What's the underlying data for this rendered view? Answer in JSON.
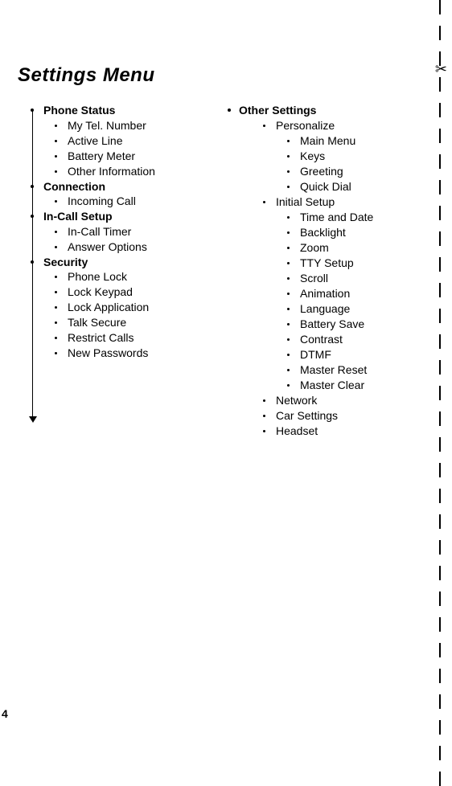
{
  "title": "Settings Menu",
  "page_number": "4",
  "scissors_icon": "✂",
  "left_column": [
    {
      "label": "Phone Status",
      "bold": true,
      "children": [
        {
          "label": "My Tel. Number"
        },
        {
          "label": "Active Line"
        },
        {
          "label": "Battery Meter"
        },
        {
          "label": "Other Information"
        }
      ]
    },
    {
      "label": "Connection",
      "bold": true,
      "children": [
        {
          "label": "Incoming Call"
        }
      ]
    },
    {
      "label": "In-Call Setup",
      "bold": true,
      "children": [
        {
          "label": "In-Call Timer"
        },
        {
          "label": "Answer Options"
        }
      ]
    },
    {
      "label": "Security",
      "bold": true,
      "children": [
        {
          "label": "Phone Lock"
        },
        {
          "label": "Lock Keypad"
        },
        {
          "label": "Lock Application"
        },
        {
          "label": "Talk Secure"
        },
        {
          "label": "Restrict Calls"
        },
        {
          "label": "New Passwords"
        }
      ]
    }
  ],
  "right_column": [
    {
      "label": "Other Settings",
      "bold": true,
      "children": [
        {
          "label": "Personalize",
          "children": [
            {
              "label": "Main Menu"
            },
            {
              "label": "Keys"
            },
            {
              "label": "Greeting"
            },
            {
              "label": "Quick Dial"
            }
          ]
        },
        {
          "label": "Initial Setup",
          "children": [
            {
              "label": "Time and Date"
            },
            {
              "label": "Backlight"
            },
            {
              "label": "Zoom"
            },
            {
              "label": "TTY Setup"
            },
            {
              "label": "Scroll"
            },
            {
              "label": "Animation"
            },
            {
              "label": "Language"
            },
            {
              "label": "Battery Save"
            },
            {
              "label": "Contrast"
            },
            {
              "label": "DTMF"
            },
            {
              "label": "Master Reset"
            },
            {
              "label": "Master Clear"
            }
          ]
        },
        {
          "label": "Network"
        },
        {
          "label": "Car Settings"
        },
        {
          "label": "Headset"
        }
      ]
    }
  ]
}
